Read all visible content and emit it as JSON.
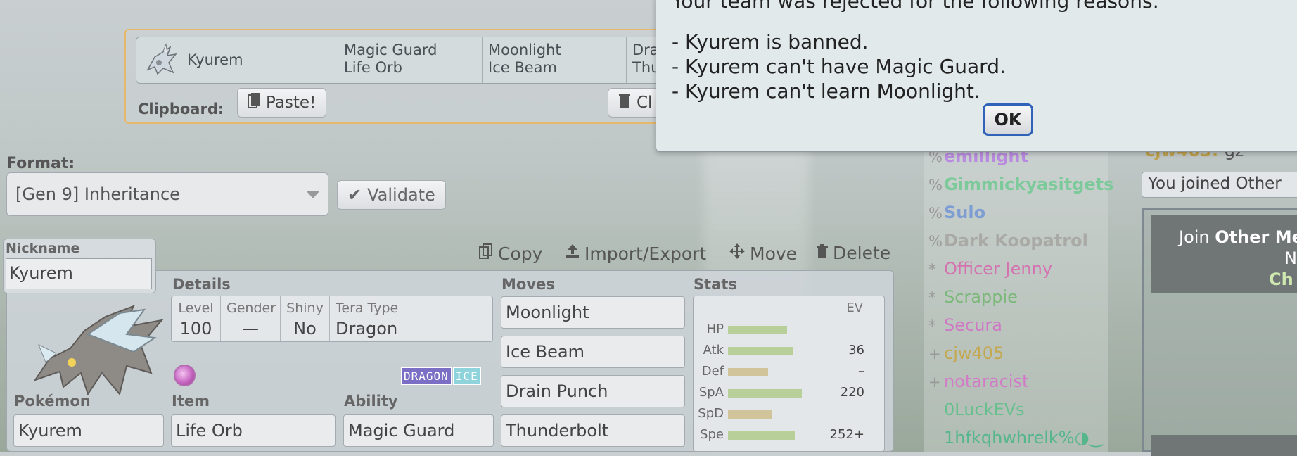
{
  "clipboard": {
    "pokemon": "Kyurem",
    "ability_item": [
      "Magic Guard",
      "Life Orb"
    ],
    "moves_a": [
      "Moonlight",
      "Ice Beam"
    ],
    "moves_b": [
      "Dra",
      "Thu"
    ],
    "label": "Clipboard:",
    "paste_label": "Paste!",
    "clear_label": "Cl"
  },
  "format": {
    "label": "Format:",
    "selected": "[Gen 9] Inheritance",
    "validate_label": "Validate"
  },
  "toolbar": {
    "copy": "Copy",
    "import_export": "Import/Export",
    "move": "Move",
    "delete": "Delete"
  },
  "set": {
    "nickname_label": "Nickname",
    "nickname": "Kyurem",
    "details_label": "Details",
    "level_label": "Level",
    "level": "100",
    "gender_label": "Gender",
    "gender": "—",
    "shiny_label": "Shiny",
    "shiny": "No",
    "tera_label": "Tera Type",
    "tera": "Dragon",
    "types": [
      "DRAGON",
      "ICE"
    ],
    "pokemon_label": "Pokémon",
    "pokemon": "Kyurem",
    "item_label": "Item",
    "item": "Life Orb",
    "ability_label": "Ability",
    "ability": "Magic Guard",
    "moves_label": "Moves",
    "moves": [
      "Moonlight",
      "Ice Beam",
      "Drain Punch",
      "Thunderbolt"
    ],
    "stats_label": "Stats",
    "ev_label": "EV",
    "stats": [
      {
        "name": "HP",
        "ev": "",
        "fill": 0.56
      },
      {
        "name": "Atk",
        "ev": "36",
        "fill": 0.62
      },
      {
        "name": "Def",
        "ev": "–",
        "fill": 0.38
      },
      {
        "name": "SpA",
        "ev": "220",
        "fill": 0.7
      },
      {
        "name": "SpD",
        "ev": "",
        "fill": 0.42
      },
      {
        "name": "Spe",
        "ev": "252+",
        "fill": 0.63
      }
    ]
  },
  "userlist": [
    {
      "rank": "%",
      "name": "emillight",
      "color": "#b98be0"
    },
    {
      "rank": "%",
      "name": "Gimmickyasitgets",
      "color": "#7cc99a"
    },
    {
      "rank": "%",
      "name": "Sulo",
      "color": "#7e9ed3"
    },
    {
      "rank": "%",
      "name": "Dark Koopatrol",
      "color": "#a9aaa5"
    },
    {
      "rank": "*",
      "name": "Officer Jenny",
      "color": "#d473b0"
    },
    {
      "rank": "*",
      "name": "Scrappie",
      "color": "#7bb87a"
    },
    {
      "rank": "*",
      "name": "Secura",
      "color": "#cf78c4"
    },
    {
      "rank": "+",
      "name": "cjw405",
      "color": "#c4a84f"
    },
    {
      "rank": "+",
      "name": "notaracist",
      "color": "#d27ac7"
    },
    {
      "rank": "",
      "name": "0LuckEVs",
      "color": "#66bf8d"
    },
    {
      "rank": "",
      "name": "1hfkqhwhrelk%◑‿",
      "color": "#54b68a"
    }
  ],
  "chat": {
    "line_user": "cjw405:",
    "line_msg": "gz",
    "joined": "You joined Other",
    "room_join": "Join",
    "room_name": "Other Me",
    "room_n": "N",
    "room_ch": "Ch"
  },
  "popup": {
    "heading": "Your team was rejected for the following reasons:",
    "reasons": [
      "- Kyurem is banned.",
      "- Kyurem can't have Magic Guard.",
      "- Kyurem can't learn Moonlight."
    ],
    "ok_label": "OK"
  }
}
